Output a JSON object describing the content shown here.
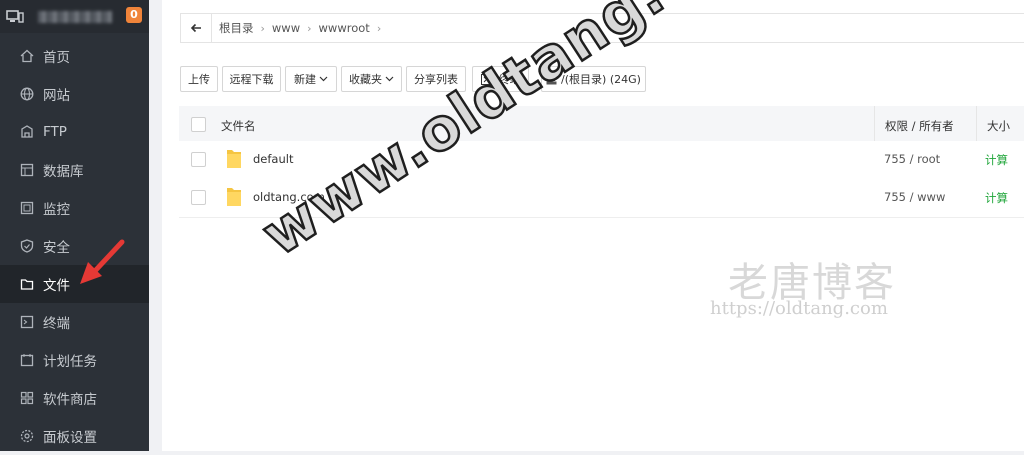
{
  "sidebar": {
    "badge": "0",
    "items": [
      {
        "label": "首页",
        "icon": "home-icon"
      },
      {
        "label": "网站",
        "icon": "globe-icon"
      },
      {
        "label": "FTP",
        "icon": "ftp-icon"
      },
      {
        "label": "数据库",
        "icon": "database-icon"
      },
      {
        "label": "监控",
        "icon": "monitor-icon"
      },
      {
        "label": "安全",
        "icon": "shield-icon"
      },
      {
        "label": "文件",
        "icon": "folder-icon",
        "active": true
      },
      {
        "label": "终端",
        "icon": "terminal-icon"
      },
      {
        "label": "计划任务",
        "icon": "clock-icon"
      },
      {
        "label": "软件商店",
        "icon": "apps-icon"
      },
      {
        "label": "面板设置",
        "icon": "settings-icon"
      }
    ]
  },
  "breadcrumb": [
    "根目录",
    "www",
    "wwwroot"
  ],
  "toolbar": {
    "upload": "上传",
    "remote_download": "远程下载",
    "new": "新建",
    "favorites": "收藏夹",
    "share_list": "分享列表",
    "terminal": "终端",
    "disk": "/(根目录) (24G)"
  },
  "table": {
    "columns": [
      "文件名",
      "权限 / 所有者",
      "大小"
    ],
    "rows": [
      {
        "name": "default",
        "perm": "755 / root",
        "size": "计算"
      },
      {
        "name": "oldtang.com",
        "perm": "755 / www",
        "size": "计算"
      }
    ]
  },
  "watermark": {
    "main": "www.oldtang.com",
    "cn": "老唐博客",
    "url": "https://oldtang.com"
  },
  "colors": {
    "sidebar_bg": "#2c3138",
    "accent_green": "#20a53a",
    "badge": "#f0843a",
    "arrow": "#e53935"
  }
}
